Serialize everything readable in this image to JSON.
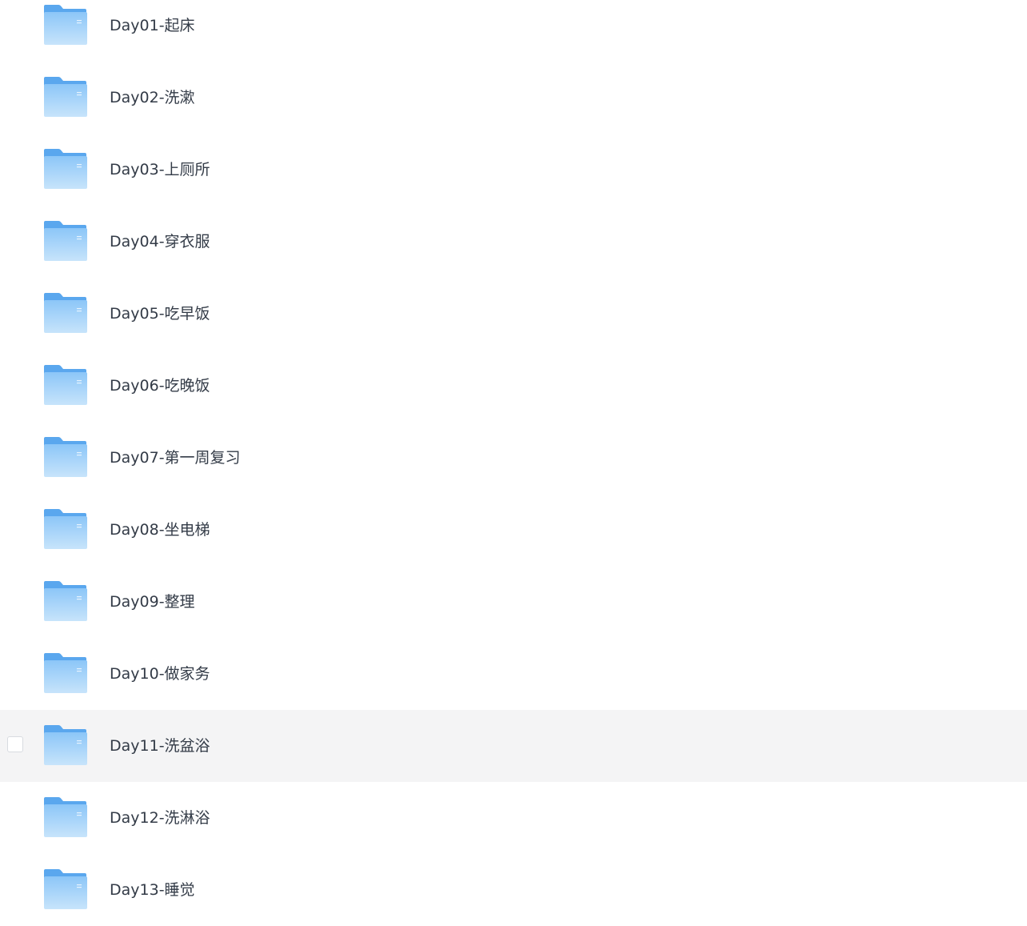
{
  "file_list": {
    "hovered_index": 10,
    "items": [
      {
        "name": "Day01-起床",
        "icon": "folder-icon"
      },
      {
        "name": "Day02-洗漱",
        "icon": "folder-icon"
      },
      {
        "name": "Day03-上厕所",
        "icon": "folder-icon"
      },
      {
        "name": "Day04-穿衣服",
        "icon": "folder-icon"
      },
      {
        "name": "Day05-吃早饭",
        "icon": "folder-icon"
      },
      {
        "name": "Day06-吃晚饭",
        "icon": "folder-icon"
      },
      {
        "name": "Day07-第一周复习",
        "icon": "folder-icon"
      },
      {
        "name": "Day08-坐电梯",
        "icon": "folder-icon"
      },
      {
        "name": "Day09-整理",
        "icon": "folder-icon"
      },
      {
        "name": "Day10-做家务",
        "icon": "folder-icon"
      },
      {
        "name": "Day11-洗盆浴",
        "icon": "folder-icon"
      },
      {
        "name": "Day12-洗淋浴",
        "icon": "folder-icon"
      },
      {
        "name": "Day13-睡觉",
        "icon": "folder-icon"
      }
    ]
  },
  "colors": {
    "folder_back": "#5aa7ee",
    "folder_front_top": "#8cc6f8",
    "folder_front_bottom": "#c7e4fb",
    "text": "#333b47",
    "hover_background": "#f4f4f5",
    "checkbox_border": "#d8dbe0"
  }
}
